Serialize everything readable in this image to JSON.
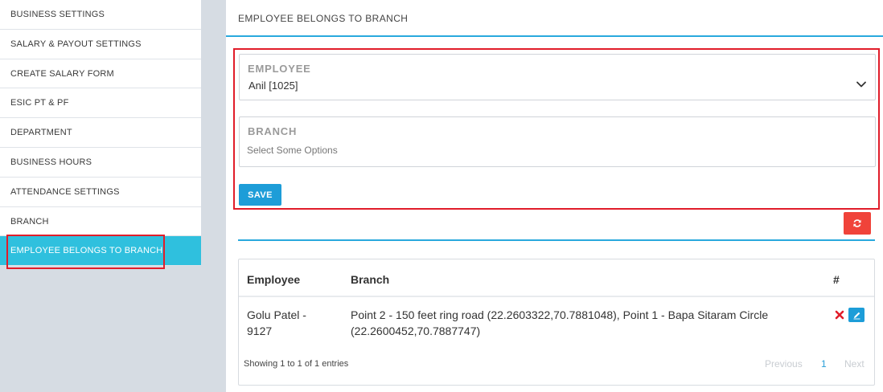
{
  "sidebar": {
    "items": [
      {
        "label": "BUSINESS SETTINGS"
      },
      {
        "label": "SALARY & PAYOUT SETTINGS"
      },
      {
        "label": "CREATE SALARY FORM"
      },
      {
        "label": "ESIC PT & PF"
      },
      {
        "label": "DEPARTMENT"
      },
      {
        "label": "BUSINESS HOURS"
      },
      {
        "label": "ATTENDANCE SETTINGS"
      },
      {
        "label": "BRANCH"
      },
      {
        "label": "EMPLOYEE BELONGS TO BRANCH"
      }
    ],
    "active_index": 8
  },
  "main": {
    "title": "EMPLOYEE BELONGS TO BRANCH"
  },
  "form": {
    "employee": {
      "label": "EMPLOYEE",
      "value": "Anil [1025]"
    },
    "branch": {
      "label": "BRANCH",
      "placeholder": "Select Some Options"
    },
    "save_label": "SAVE"
  },
  "table": {
    "headers": {
      "employee": "Employee",
      "branch": "Branch",
      "actions": "#"
    },
    "rows": [
      {
        "employee_line1": "Golu Patel -",
        "employee_line2": "9127",
        "branch_line1": "Point 2 - 150 feet ring road (22.2603322,70.7881048), Point 1 - Bapa Sitaram Circle",
        "branch_line2": "(22.2600452,70.7887747)"
      }
    ],
    "info": "Showing 1 to 1 of 1 entries",
    "pagination": {
      "previous": "Previous",
      "page": "1",
      "next": "Next"
    }
  },
  "icons": {
    "chevron": "chevron-down-icon",
    "refresh": "refresh-icon",
    "delete": "close-icon",
    "edit": "pencil-icon"
  },
  "colors": {
    "accent": "#29a9dd",
    "active_item": "#2fc0de",
    "highlight": "#e11d2a",
    "danger": "#f0433a"
  }
}
